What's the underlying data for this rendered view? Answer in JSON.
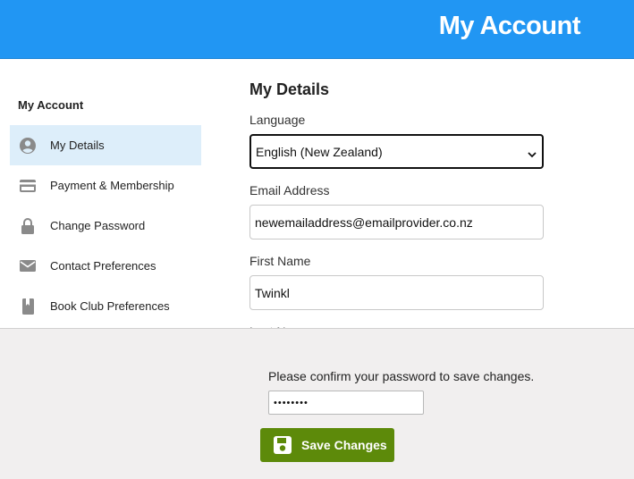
{
  "header": {
    "title": "My Account"
  },
  "sidebar": {
    "title": "My Account",
    "items": [
      {
        "label": "My Details",
        "icon": "user-circle-icon",
        "active": true
      },
      {
        "label": "Payment & Membership",
        "icon": "credit-card-icon",
        "active": false
      },
      {
        "label": "Change Password",
        "icon": "lock-icon",
        "active": false
      },
      {
        "label": "Contact Preferences",
        "icon": "envelope-icon",
        "active": false
      },
      {
        "label": "Book Club Preferences",
        "icon": "book-icon",
        "active": false
      }
    ]
  },
  "main": {
    "title": "My Details",
    "language": {
      "label": "Language",
      "value": "English (New Zealand)"
    },
    "email": {
      "label": "Email Address",
      "value": "newemailaddress@emailprovider.co.nz"
    },
    "first_name": {
      "label": "First Name",
      "value": "Twinkl"
    },
    "last_name": {
      "label": "Last Name"
    }
  },
  "footer": {
    "confirm_text": "Please confirm your password to save changes.",
    "password_value": "••••••••",
    "save_label": "Save Changes"
  },
  "colors": {
    "header_bg": "#2196f3",
    "active_item_bg": "#ddeefa",
    "save_button_bg": "#5d8a0a",
    "footer_bg": "#f1efef"
  }
}
